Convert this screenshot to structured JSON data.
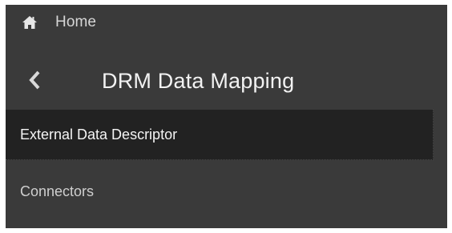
{
  "header": {
    "home_label": "Home",
    "home_icon": "home-icon"
  },
  "title_bar": {
    "back_icon": "chevron-left-icon",
    "title": "DRM Data Mapping"
  },
  "nav": {
    "items": [
      {
        "label": "External Data Descriptor",
        "selected": true
      },
      {
        "label": "Connectors",
        "selected": false
      }
    ]
  },
  "colors": {
    "panel_background": "#3a3a3a",
    "selected_item_background": "#222222",
    "title_text": "#f2f2f2",
    "secondary_text": "#cfcfcf"
  }
}
